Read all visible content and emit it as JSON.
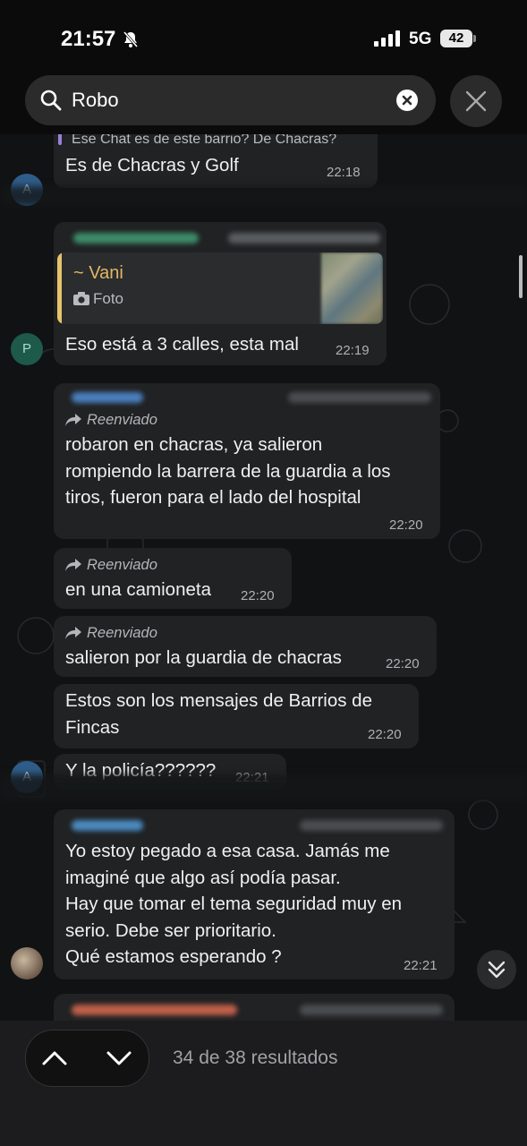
{
  "status_bar": {
    "time": "21:57",
    "network": "5G",
    "battery": "42"
  },
  "search": {
    "query": "Robo"
  },
  "messages": {
    "partial_top_quote": "Ese Chat es de este barrio? De Chacras?",
    "m1": {
      "text": "Es de Chacras y Golf",
      "time": "22:18"
    },
    "m2": {
      "quote_name": "~ Vani",
      "quote_type": "Foto",
      "text": "Eso está a 3 calles, esta mal",
      "time": "22:19",
      "avatar": "P"
    },
    "m3": {
      "forwarded": "Reenviado",
      "text": "robaron en chacras, ya salieron\nrompiendo la barrera de la guardia a los\ntiros, fueron para el lado del hospital",
      "time": "22:20"
    },
    "m4": {
      "forwarded": "Reenviado",
      "text": "en una camioneta",
      "time": "22:20"
    },
    "m5": {
      "forwarded": "Reenviado",
      "text": "salieron por la guardia de chacras",
      "time": "22:20"
    },
    "m6": {
      "text": "Estos son los mensajes de Barrios de\nFincas",
      "time": "22:20"
    },
    "m7": {
      "text": "Y la policía??????",
      "time": "22:21"
    },
    "m8": {
      "text": "Yo estoy pegado a esa casa. Jamás me\nimaginé que algo así podía  pasar.\nHay que tomar el tema seguridad muy en\nserio. Debe ser prioritario.\nQué estamos esperando ?",
      "time": "22:21"
    }
  },
  "bottom_bar": {
    "results": "34 de 38 resultados"
  },
  "colors": {
    "bubble": "#202223",
    "quote_accent": "#e7c36b",
    "background": "#111214"
  }
}
